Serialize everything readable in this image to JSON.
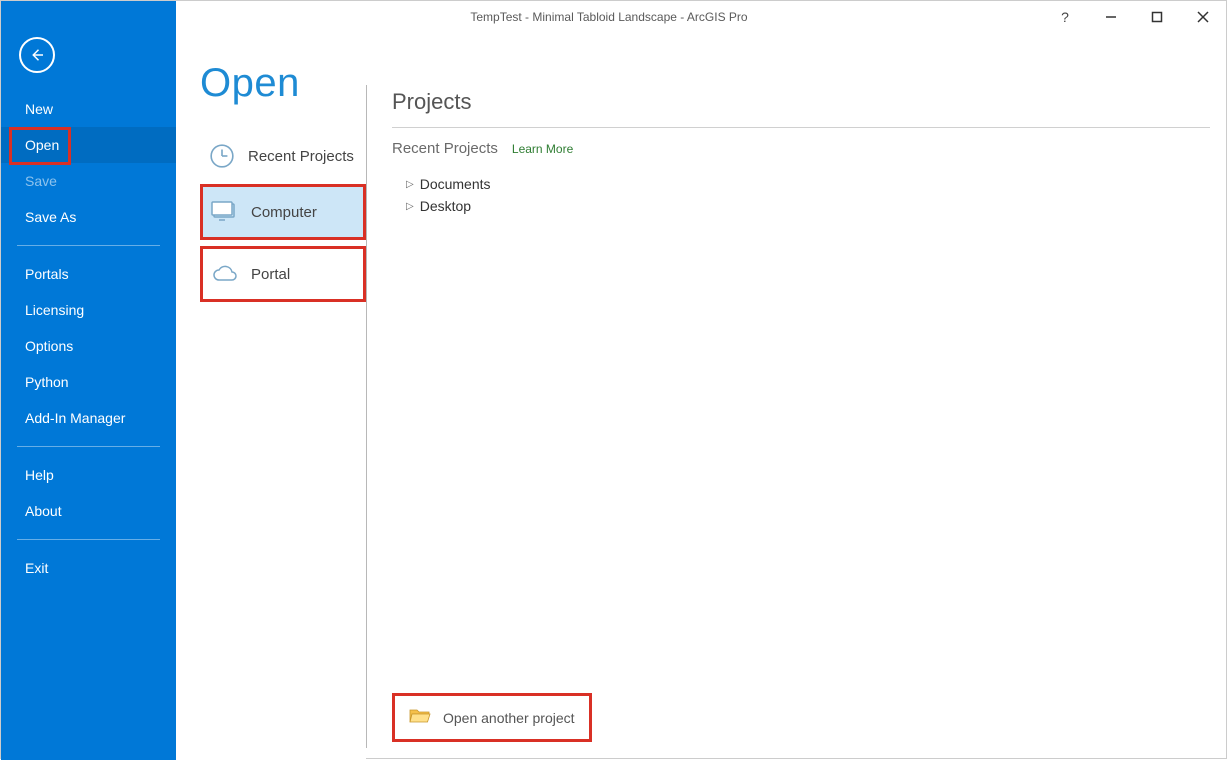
{
  "window": {
    "title": "TempTest - Minimal Tabloid Landscape - ArcGIS Pro"
  },
  "sidebar": {
    "items": [
      {
        "label": "New"
      },
      {
        "label": "Open"
      },
      {
        "label": "Save"
      },
      {
        "label": "Save As"
      }
    ],
    "items2": [
      {
        "label": "Portals"
      },
      {
        "label": "Licensing"
      },
      {
        "label": "Options"
      },
      {
        "label": "Python"
      },
      {
        "label": "Add-In Manager"
      }
    ],
    "items3": [
      {
        "label": "Help"
      },
      {
        "label": "About"
      }
    ],
    "items4": [
      {
        "label": "Exit"
      }
    ]
  },
  "page": {
    "title": "Open"
  },
  "sources": [
    {
      "label": "Recent Projects"
    },
    {
      "label": "Computer"
    },
    {
      "label": "Portal"
    }
  ],
  "detail": {
    "heading": "Projects",
    "subheading": "Recent Projects",
    "learn": "Learn More",
    "tree": [
      {
        "label": "Documents"
      },
      {
        "label": "Desktop"
      }
    ],
    "open_another": "Open another project"
  }
}
